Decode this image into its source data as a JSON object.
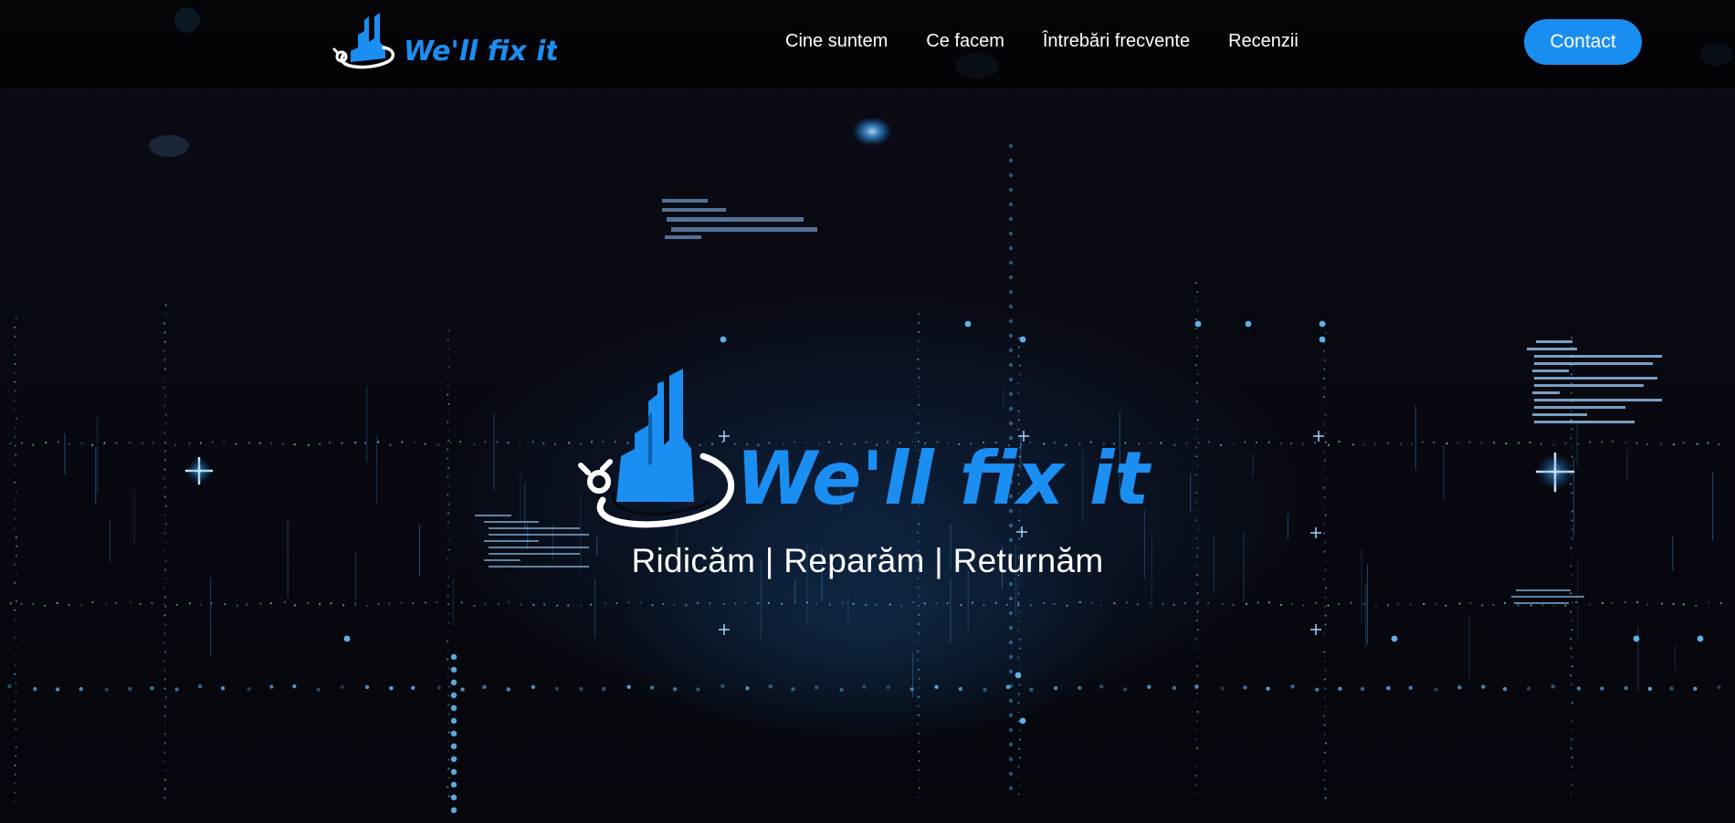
{
  "header": {
    "logo_text": "We'll fix it",
    "nav": [
      {
        "label": "Cine suntem"
      },
      {
        "label": "Ce facem"
      },
      {
        "label": "Întrebări frecvente"
      },
      {
        "label": "Recenzii"
      }
    ],
    "contact_label": "Contact"
  },
  "hero": {
    "logo_text": "We'll fix it",
    "tagline": "Ridicăm | Reparăm | Returnăm"
  },
  "colors": {
    "accent": "#1a8ef0",
    "logo_blue": "#1b8ef2",
    "background": "#07080f",
    "text": "#ffffff"
  }
}
